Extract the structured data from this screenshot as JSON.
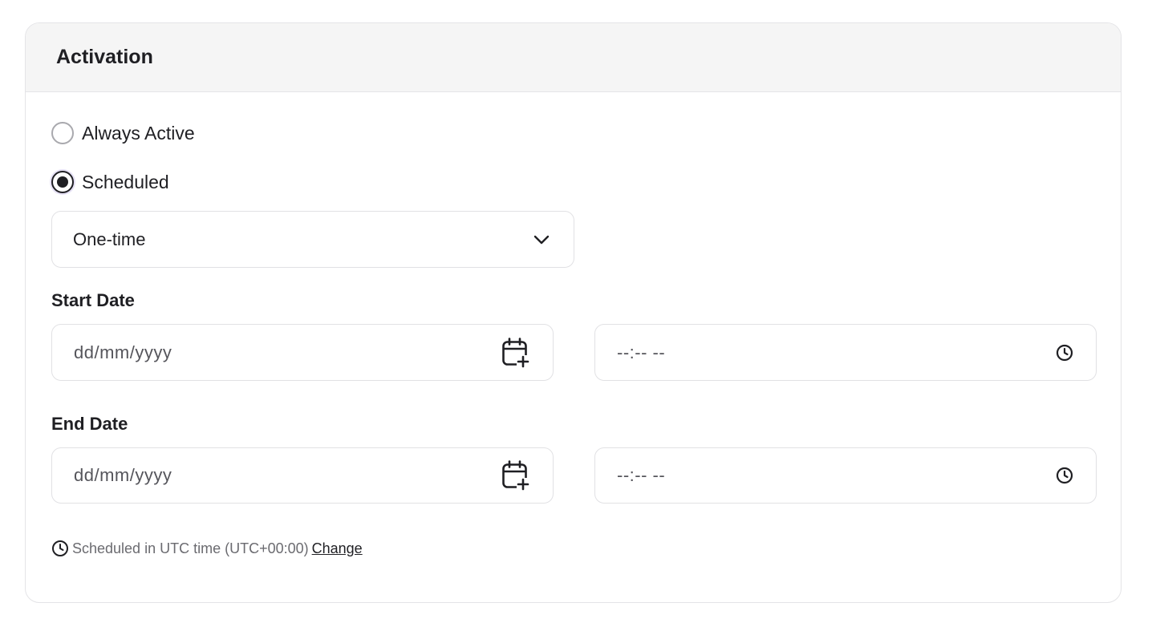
{
  "card": {
    "title": "Activation"
  },
  "activation_mode": {
    "options": [
      {
        "label": "Always Active",
        "selected": false
      },
      {
        "label": "Scheduled",
        "selected": true
      }
    ]
  },
  "schedule_type": {
    "selected": "One-time",
    "icon": "chevron-down-icon"
  },
  "start": {
    "label": "Start Date",
    "date_placeholder": "dd/mm/yyyy",
    "time_placeholder": "--:-- --",
    "date_icon": "calendar-plus-icon",
    "time_icon": "clock-icon"
  },
  "end": {
    "label": "End Date",
    "date_placeholder": "dd/mm/yyyy",
    "time_placeholder": "--:-- --",
    "date_icon": "calendar-plus-icon",
    "time_icon": "clock-icon"
  },
  "timezone": {
    "icon": "clock-icon",
    "text": "Scheduled in UTC time (UTC+00:00)",
    "change_link": "Change"
  },
  "colors": {
    "text": "#1f1f23",
    "muted": "#6b6b70",
    "border": "#e1e1e4",
    "header_bg": "#f5f5f5",
    "radio_focus_ring": "#e6e1f5"
  }
}
